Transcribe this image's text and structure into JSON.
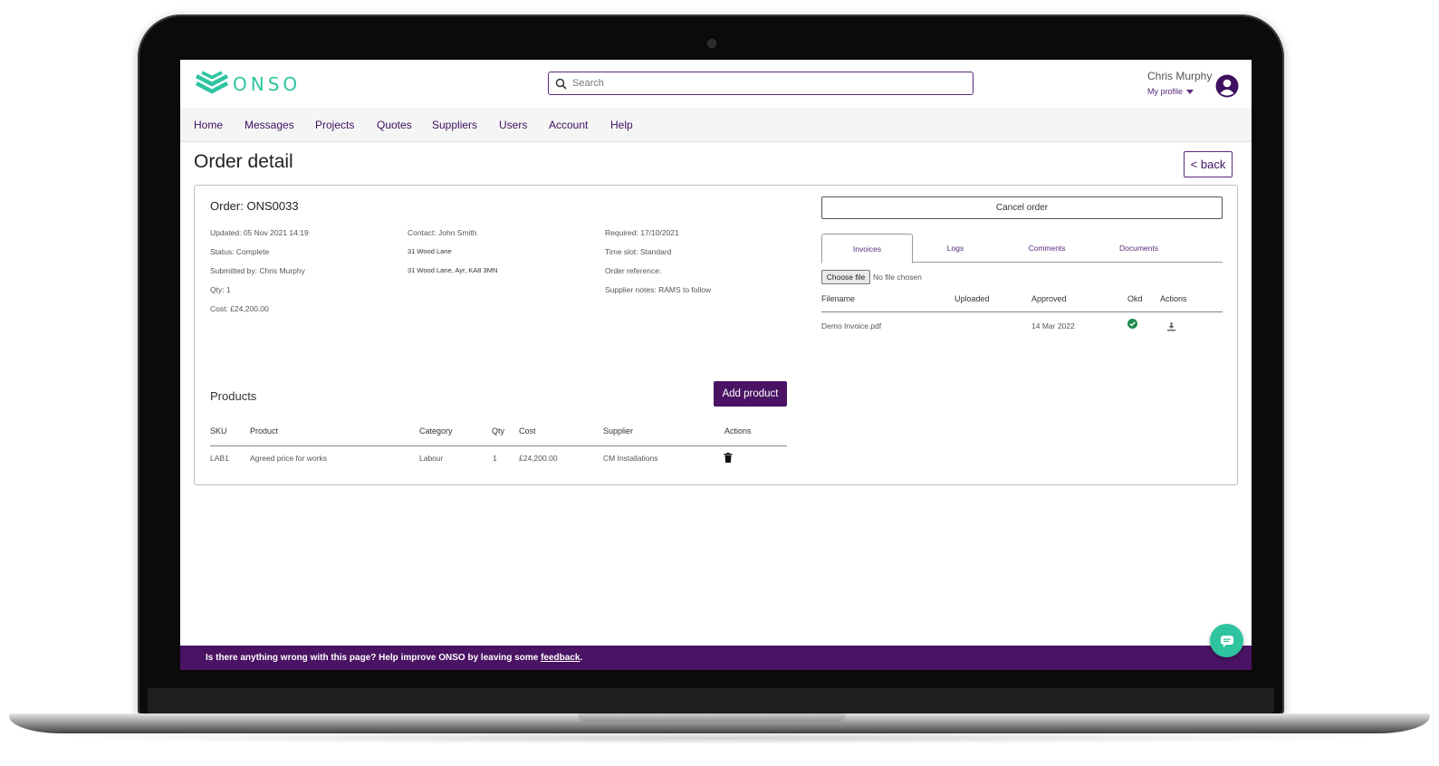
{
  "header": {
    "logo_text": "ONSO",
    "search_placeholder": "Search",
    "user_name": "Chris Murphy",
    "profile_label": "My profile"
  },
  "nav": {
    "items": [
      "Home",
      "Messages",
      "Projects",
      "Quotes",
      "Suppliers",
      "Users",
      "Account",
      "Help"
    ]
  },
  "page": {
    "title": "Order detail",
    "back_label": "< back"
  },
  "order": {
    "title": "Order: ONS0033",
    "col1": [
      "Updated: 05 Nov 2021 14:19",
      "Status: Complete",
      "Submitted by: Chris Murphy",
      "Qty: 1",
      "Cost: £24,200.00"
    ],
    "col2": [
      "Contact: John Smith",
      "31 Wood Lane",
      "31 Wood Lane, Ayr, KA8 3MN"
    ],
    "col3": [
      "Required: 17/10/2021",
      "Time slot: Standard",
      "Order reference:",
      "Supplier notes: RAMS to follow"
    ]
  },
  "products": {
    "title": "Products",
    "add_label": "Add product",
    "columns": [
      "SKU",
      "Product",
      "Category",
      "Qty",
      "Cost",
      "Supplier",
      "Actions"
    ],
    "rows": [
      {
        "sku": "LAB1",
        "product": "Agreed price for works",
        "category": "Labour",
        "qty": "1",
        "cost": "£24,200.00",
        "supplier": "CM Installations"
      }
    ]
  },
  "side": {
    "cancel_label": "Cancel order",
    "tabs": [
      "Invoices",
      "Logs",
      "Comments",
      "Documents"
    ],
    "active_tab": "Invoices",
    "choose_file_label": "Choose file",
    "no_file_text": "No file chosen",
    "invoice_columns": [
      "Filename",
      "Uploaded",
      "Approved",
      "Okd",
      "Actions"
    ],
    "invoices": [
      {
        "filename": "Demo Invoice.pdf",
        "uploaded": "",
        "approved": "14 Mar 2022"
      }
    ]
  },
  "footer": {
    "feedback_text": "Is there anything wrong with this page? Help improve ONSO by leaving some ",
    "feedback_link": "feedback",
    "feedback_end": "."
  },
  "colors": {
    "brand_purple": "#4a1363",
    "brand_teal": "#2ec4a0",
    "ok_green": "#1e8a4c"
  }
}
